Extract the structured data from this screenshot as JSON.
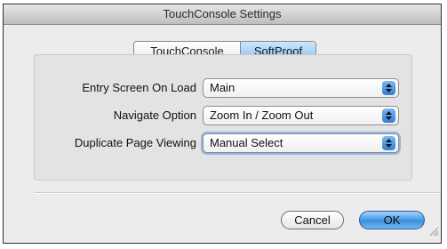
{
  "window": {
    "title": "TouchConsole Settings"
  },
  "tabs": [
    {
      "label": "TouchConsole",
      "selected": false
    },
    {
      "label": "SoftProof",
      "selected": true
    }
  ],
  "settings": [
    {
      "label": "Entry Screen On Load",
      "value": "Main"
    },
    {
      "label": "Navigate Option",
      "value": "Zoom In / Zoom Out"
    },
    {
      "label": "Duplicate Page Viewing",
      "value": "Manual Select"
    }
  ],
  "buttons": {
    "cancel": "Cancel",
    "ok": "OK"
  },
  "icons": {
    "popup": "up-down-arrows-icon",
    "resize": "resize-grip-icon"
  },
  "colors": {
    "accent": "#3b8fe0",
    "selected_tab": "#8cc1f2"
  }
}
